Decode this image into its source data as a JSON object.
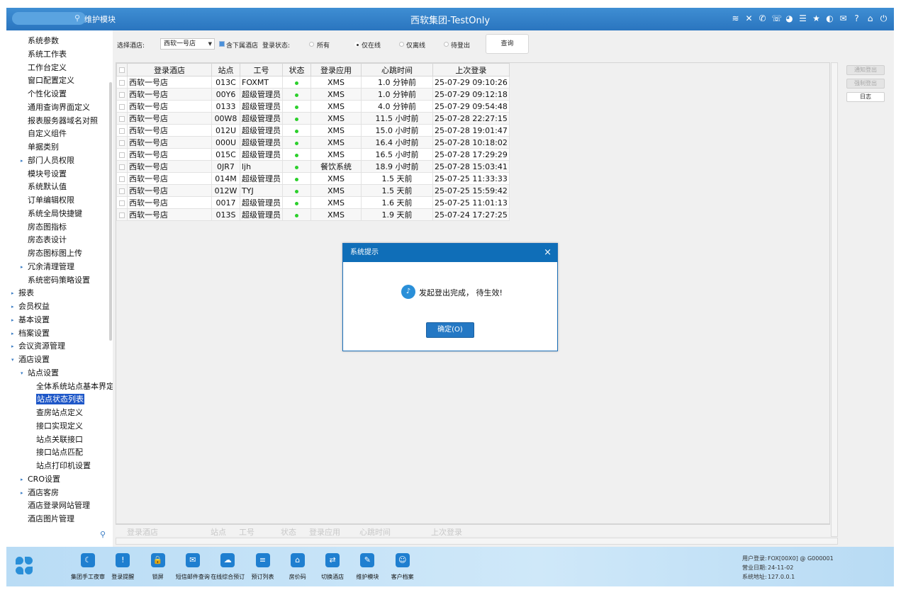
{
  "titlebar": {
    "module": "维护模块",
    "title": "西软集团-TestOnly",
    "icons": [
      "wifi-icon",
      "tools-icon",
      "phone-icon",
      "support-icon",
      "palette-icon",
      "menu-icon",
      "star-icon",
      "moon-icon",
      "mail-icon",
      "help-icon",
      "home-icon",
      "power-icon"
    ]
  },
  "sidebar": {
    "items": [
      {
        "label": "系统参数",
        "level": 2,
        "arrow": ""
      },
      {
        "label": "系统工作表",
        "level": 2,
        "arrow": ""
      },
      {
        "label": "工作台定义",
        "level": 2,
        "arrow": ""
      },
      {
        "label": "窗口配置定义",
        "level": 2,
        "arrow": ""
      },
      {
        "label": "个性化设置",
        "level": 2,
        "arrow": ""
      },
      {
        "label": "通用查询界面定义",
        "level": 2,
        "arrow": ""
      },
      {
        "label": "报表服务器域名对照",
        "level": 2,
        "arrow": ""
      },
      {
        "label": "自定义组件",
        "level": 2,
        "arrow": ""
      },
      {
        "label": "单据类别",
        "level": 2,
        "arrow": ""
      },
      {
        "label": "部门人员权限",
        "level": 2,
        "arrow": "▸"
      },
      {
        "label": "模块号设置",
        "level": 2,
        "arrow": ""
      },
      {
        "label": "系统默认值",
        "level": 2,
        "arrow": ""
      },
      {
        "label": "订单编辑权限",
        "level": 2,
        "arrow": ""
      },
      {
        "label": "系统全局快捷键",
        "level": 2,
        "arrow": ""
      },
      {
        "label": "房态图指标",
        "level": 2,
        "arrow": ""
      },
      {
        "label": "房态表设计",
        "level": 2,
        "arrow": ""
      },
      {
        "label": "房态图标图上传",
        "level": 2,
        "arrow": ""
      },
      {
        "label": "冗余清理管理",
        "level": 2,
        "arrow": "▸"
      },
      {
        "label": "系统密码策略设置",
        "level": 2,
        "arrow": ""
      },
      {
        "label": "报表",
        "level": 1,
        "arrow": "▸"
      },
      {
        "label": "会员权益",
        "level": 1,
        "arrow": "▸"
      },
      {
        "label": "基本设置",
        "level": 1,
        "arrow": "▸"
      },
      {
        "label": "档案设置",
        "level": 1,
        "arrow": "▸"
      },
      {
        "label": "会议资源管理",
        "level": 1,
        "arrow": "▸"
      },
      {
        "label": "酒店设置",
        "level": 1,
        "arrow": "▾"
      },
      {
        "label": "站点设置",
        "level": 2,
        "arrow": "▾"
      },
      {
        "label": "全体系统站点基本界定",
        "level": 3,
        "arrow": ""
      },
      {
        "label": "站点状态列表",
        "level": 3,
        "arrow": "",
        "selected": true
      },
      {
        "label": "查房站点定义",
        "level": 3,
        "arrow": ""
      },
      {
        "label": "接口实现定义",
        "level": 3,
        "arrow": ""
      },
      {
        "label": "站点关联接口",
        "level": 3,
        "arrow": ""
      },
      {
        "label": "接口站点匹配",
        "level": 3,
        "arrow": ""
      },
      {
        "label": "站点打印机设置",
        "level": 3,
        "arrow": ""
      },
      {
        "label": "CRO设置",
        "level": 2,
        "arrow": "▸"
      },
      {
        "label": "酒店客房",
        "level": 2,
        "arrow": "▸"
      },
      {
        "label": "酒店登录网站管理",
        "level": 2,
        "arrow": ""
      },
      {
        "label": "酒店图片管理",
        "level": 2,
        "arrow": ""
      }
    ]
  },
  "filter": {
    "hotel_label": "选择酒店:",
    "hotel_value": "西软一号店",
    "include_sub_label": "含下属酒店",
    "status_label": "登录状态:",
    "options": [
      "所有",
      "仅在线",
      "仅离线",
      "待登出"
    ],
    "selected_option": "仅在线",
    "query_label": "查询"
  },
  "table": {
    "columns": [
      "登录酒店",
      "站点",
      "工号",
      "状态",
      "登录应用",
      "心跳时间",
      "上次登录"
    ],
    "rows": [
      [
        "西软一号店",
        "013C",
        "FOXMT",
        "",
        "XMS",
        "1.0 分钟前",
        "25-07-29 09:10:26"
      ],
      [
        "西软一号店",
        "00Y6",
        "超级管理员",
        "",
        "XMS",
        "1.0 分钟前",
        "25-07-29 09:12:18"
      ],
      [
        "西软一号店",
        "0133",
        "超级管理员",
        "",
        "XMS",
        "4.0 分钟前",
        "25-07-29 09:54:48"
      ],
      [
        "西软一号店",
        "00W8",
        "超级管理员",
        "",
        "XMS",
        "11.5 小时前",
        "25-07-28 22:27:15"
      ],
      [
        "西软一号店",
        "012U",
        "超级管理员",
        "",
        "XMS",
        "15.0 小时前",
        "25-07-28 19:01:47"
      ],
      [
        "西软一号店",
        "000U",
        "超级管理员",
        "",
        "XMS",
        "16.4 小时前",
        "25-07-28 10:18:02"
      ],
      [
        "西软一号店",
        "015C",
        "超级管理员",
        "",
        "XMS",
        "16.5 小时前",
        "25-07-28 17:29:29"
      ],
      [
        "西软一号店",
        "0JR7",
        "ljh",
        "",
        "餐饮系统",
        "18.9 小时前",
        "25-07-28 15:03:41"
      ],
      [
        "西软一号店",
        "014M",
        "超级管理员",
        "",
        "XMS",
        "1.5 天前",
        "25-07-25 11:33:33"
      ],
      [
        "西软一号店",
        "012W",
        "TYJ",
        "",
        "XMS",
        "1.5 天前",
        "25-07-25 15:59:42"
      ],
      [
        "西软一号店",
        "0017",
        "超级管理员",
        "",
        "XMS",
        "1.6 天前",
        "25-07-25 11:01:13"
      ],
      [
        "西软一号店",
        "013S",
        "超级管理员",
        "",
        "XMS",
        "1.9 天前",
        "25-07-24 17:27:25"
      ]
    ],
    "status_color": "#2bcf2b"
  },
  "side_buttons": {
    "notify_logout": "通知登出",
    "force_logout": "强制登出",
    "log": "日志"
  },
  "dialog": {
    "title": "系统提示",
    "message": "发起登出完成， 待生效!",
    "ok_label": "确定(O)",
    "close_glyph": "×"
  },
  "taskbar": {
    "buttons": [
      {
        "label": "集团手工夜审",
        "icon": "night-audit-icon",
        "glyph": "☾"
      },
      {
        "label": "登录提醒",
        "icon": "reminder-icon",
        "glyph": "!"
      },
      {
        "label": "锁屏",
        "icon": "lock-icon",
        "glyph": "🔒"
      },
      {
        "label": "短信邮件查询",
        "icon": "mail-icon",
        "glyph": "✉"
      },
      {
        "label": "在线综合预订",
        "icon": "cloud-icon",
        "glyph": "☁"
      },
      {
        "label": "预订列表",
        "icon": "list-icon",
        "glyph": "≡"
      },
      {
        "label": "房价码",
        "icon": "house-icon",
        "glyph": "⌂"
      },
      {
        "label": "切换酒店",
        "icon": "switch-icon",
        "glyph": "⇄"
      },
      {
        "label": "维护模块",
        "icon": "wrench-icon",
        "glyph": "✎"
      },
      {
        "label": "客户档案",
        "icon": "profile-icon",
        "glyph": "☺"
      }
    ],
    "sysinfo": {
      "user_label": "用户登录:",
      "user_value": "FOX[00X0] @ G000001",
      "date_label": "营业日期:",
      "date_value": "24-11-02",
      "addr_label": "系统地址:",
      "addr_value": "127.0.0.1"
    }
  }
}
